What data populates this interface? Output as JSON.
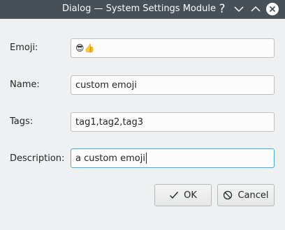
{
  "window": {
    "title": "Dialog — System Settings Module",
    "help_glyph": "?"
  },
  "form": {
    "emoji": {
      "label": "Emoji:",
      "value": "😎👍"
    },
    "name": {
      "label": "Name:",
      "value": "custom emoji"
    },
    "tags": {
      "label": "Tags:",
      "value": "tag1,tag2,tag3"
    },
    "description": {
      "label": "Description:",
      "value": "a custom emoji"
    }
  },
  "buttons": {
    "ok_label": "OK",
    "cancel_label": "Cancel"
  },
  "colors": {
    "titlebar": "#475057",
    "window_bg": "#eff0f1",
    "focus_accent": "#3daee9"
  }
}
